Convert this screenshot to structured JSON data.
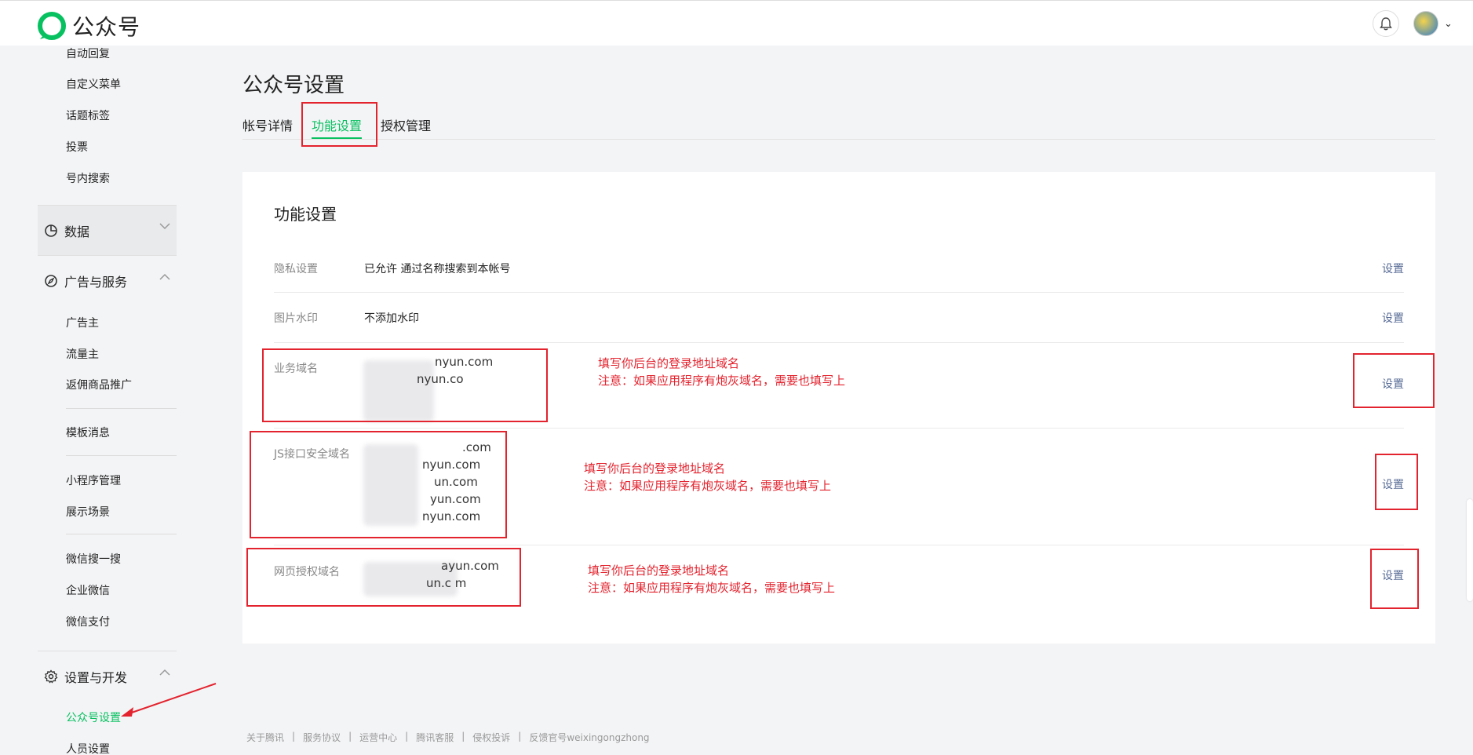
{
  "app": {
    "logo_text": "公众号"
  },
  "topbar": {
    "bell_icon": "bell-icon",
    "avatar_icon": "avatar",
    "chevron_icon": "chevron-down-icon"
  },
  "sidebar": {
    "items_top": [
      "自动回复",
      "自定义菜单",
      "话题标签",
      "投票",
      "号内搜索"
    ],
    "group_data": "数据",
    "group_ads": "广告与服务",
    "ads_items": [
      "广告主",
      "流量主",
      "返佣商品推广"
    ],
    "item_template": "模板消息",
    "items_mini": [
      "小程序管理",
      "展示场景"
    ],
    "items_wx": [
      "微信搜一搜",
      "企业微信",
      "微信支付"
    ],
    "group_settings": "设置与开发",
    "settings_items": [
      "公众号设置",
      "人员设置"
    ]
  },
  "main": {
    "title": "公众号设置",
    "tabs": [
      "帐号详情",
      "功能设置",
      "授权管理"
    ],
    "card_title": "功能设置",
    "rows": [
      {
        "label": "隐私设置",
        "value": "已允许 通过名称搜索到本帐号",
        "action": "设置"
      },
      {
        "label": "图片水印",
        "value": "不添加水印",
        "action": "设置"
      },
      {
        "label": "业务域名",
        "domains": [
          "nyun.com",
          "nyun.co",
          ""
        ],
        "action": "设置"
      },
      {
        "label": "JS接口安全域名",
        "domains": [
          ".com",
          "nyun.com",
          "un.com",
          "yun.com",
          "nyun.com"
        ],
        "action": "设置"
      },
      {
        "label": "网页授权域名",
        "domains": [
          "ayun.com",
          "un.c m"
        ],
        "action": "设置"
      }
    ]
  },
  "annotations": {
    "note_line1": "填写你后台的登录地址域名",
    "note_line2": "注意：如果应用程序有炮灰域名，需要也填写上"
  },
  "footer": [
    "关于腾讯",
    "服务协议",
    "运营中心",
    "腾讯客服",
    "侵权投诉",
    "反馈官号weixingongzhong"
  ],
  "colors": {
    "accent": "#07c160",
    "annotation": "#e3232e",
    "link": "#576b95"
  }
}
